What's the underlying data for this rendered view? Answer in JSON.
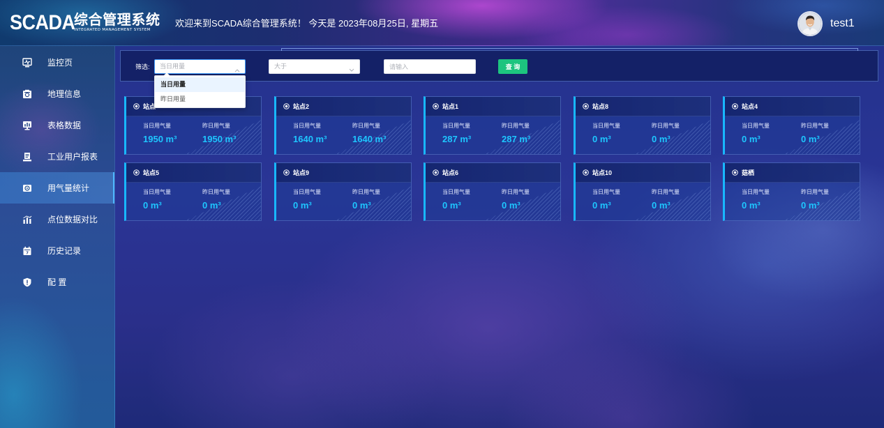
{
  "header": {
    "logo_main": "SCADA",
    "logo_cn": "综合管理系统",
    "logo_sub": "INTEGRATED MANAGEMENT SYSTEM",
    "welcome": "欢迎来到SCADA综合管理系统！ 今天是 2023年08月25日, 星期五",
    "username": "test1"
  },
  "sidebar": {
    "active_index": 4,
    "items": [
      {
        "label": "监控页",
        "icon": "monitor-pulse-icon"
      },
      {
        "label": "地理信息",
        "icon": "map-info-icon"
      },
      {
        "label": "表格数据",
        "icon": "data-screen-icon"
      },
      {
        "label": "工业用户报表",
        "icon": "report-icon"
      },
      {
        "label": "用气量统计",
        "icon": "gas-stats-icon"
      },
      {
        "label": "点位数据对比",
        "icon": "bar-chart-icon"
      },
      {
        "label": "历史记录",
        "icon": "calendar-icon"
      },
      {
        "label": "配 置",
        "icon": "shield-alert-icon"
      }
    ]
  },
  "filter": {
    "label": "筛选:",
    "field_select": {
      "value": "当日用量",
      "open": true,
      "highlighted_index": 0,
      "options": [
        "当日用量",
        "昨日用量"
      ]
    },
    "operator_select": {
      "value": "大于"
    },
    "value_input": {
      "placeholder": "请输入",
      "value": ""
    },
    "query_button": "查 询"
  },
  "cards": {
    "labels": {
      "today": "当日用气量",
      "yesterday": "昨日用气量"
    },
    "unit": "m³",
    "items": [
      {
        "title": "站点",
        "today": 1950,
        "yesterday": 1950
      },
      {
        "title": "站点2",
        "today": 1640,
        "yesterday": 1640
      },
      {
        "title": "站点1",
        "today": 287,
        "yesterday": 287
      },
      {
        "title": "站点8",
        "today": 0,
        "yesterday": 0
      },
      {
        "title": "站点4",
        "today": 0,
        "yesterday": 0
      },
      {
        "title": "站点5",
        "today": 0,
        "yesterday": 0
      },
      {
        "title": "站点9",
        "today": 0,
        "yesterday": 0
      },
      {
        "title": "站点6",
        "today": 0,
        "yesterday": 0
      },
      {
        "title": "站点10",
        "today": 0,
        "yesterday": 0
      },
      {
        "title": "菇栖",
        "today": 0,
        "yesterday": 0
      }
    ]
  },
  "colors": {
    "card_accent": "#18b8ff",
    "value_text": "#1ec6ff",
    "query_button": "#1dc47f",
    "select_focus": "#409eff"
  }
}
